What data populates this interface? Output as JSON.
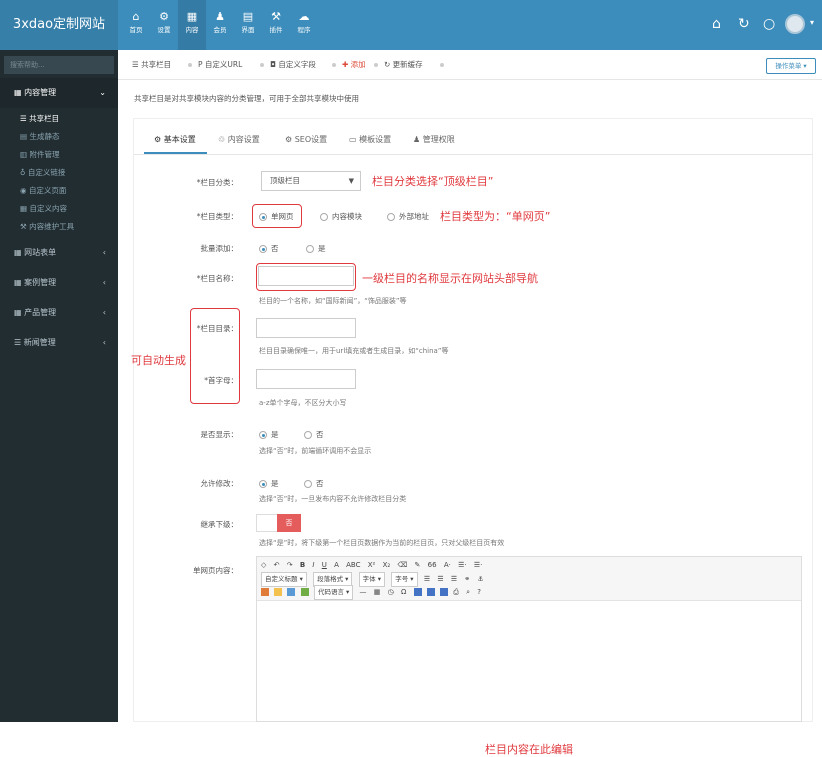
{
  "app": {
    "logo": "3xdao定制网站"
  },
  "topnav": [
    {
      "icon": "home-icon",
      "glyph": "⌂",
      "label": "首页"
    },
    {
      "icon": "gear-icon",
      "glyph": "⚙",
      "label": "设置"
    },
    {
      "icon": "grid-icon",
      "glyph": "▦",
      "label": "内容"
    },
    {
      "icon": "user-icon",
      "glyph": "♟",
      "label": "会员"
    },
    {
      "icon": "layout-icon",
      "glyph": "▤",
      "label": "界面"
    },
    {
      "icon": "plugin-icon",
      "glyph": "⚒",
      "label": "插件"
    },
    {
      "icon": "cloud-icon",
      "glyph": "☁",
      "label": "程序"
    }
  ],
  "topright": {
    "home": "⌂",
    "refresh": "↻",
    "power": "○"
  },
  "sidebar": {
    "search_placeholder": "搜索帮助...",
    "group_content": "内容管理",
    "items": [
      "共享栏目",
      "生成静态",
      "附件管理",
      "自定义链接",
      "自定义页面",
      "自定义内容",
      "内容维护工具"
    ],
    "groups": [
      "网站表单",
      "案例管理",
      "产品管理",
      "新闻管理"
    ]
  },
  "crumbs": [
    "共享栏目",
    "自定义URL",
    "自定义字段",
    "添加",
    "更新缓存"
  ],
  "ops_button": "操作菜单",
  "description": "共享栏目是对共享模块内容的分类管理，可用于全部共享模块中使用",
  "tabs": [
    "基本设置",
    "内容设置",
    "SEO设置",
    "模板设置",
    "管理权限"
  ],
  "form": {
    "category_label": "*栏目分类：",
    "category_value": "顶级栏目",
    "type_label": "*栏目类型：",
    "type_options": [
      "单网页",
      "内容模块",
      "外部地址"
    ],
    "batch_label": "批量添加：",
    "no": "否",
    "yes": "是",
    "name_label": "*栏目名称：",
    "name_hint": "栏目的一个名称，如“国际新闻”，“饰品服装”等",
    "dir_label": "*栏目目录：",
    "dir_hint": "栏目目录确保唯一，用于url填充或者生成目录，如“china”等",
    "initial_label": "*首字母：",
    "initial_hint": "a-z单个字母，不区分大小写",
    "show_label": "是否显示：",
    "show_hint": "选择“否”时，前端循环调用不会显示",
    "edit_label": "允许修改：",
    "edit_hint": "选择“否”时，一旦发布内容不允许修改栏目分类",
    "inherit_label": "继承下级：",
    "inherit_value": "否",
    "inherit_hint": "选择“是”时，将下级第一个栏目页数据作为当前的栏目页，只对父级栏目页有效",
    "page_content_label": "单网页内容："
  },
  "editor": {
    "row1": [
      "B",
      "I",
      "U",
      "A",
      "ABC",
      "X²",
      "X₂",
      "66",
      "A·",
      "☰·",
      "☰·"
    ],
    "row2_combos": [
      "自定义标题",
      "段落格式",
      "字体",
      "字号"
    ],
    "code_lang": "代码语言",
    "content_note": "栏目内容在此编辑"
  },
  "annotations": {
    "category": "栏目分类选择“顶级栏目”",
    "type": "栏目类型为：“单网页”",
    "name": "一级栏目的名称显示在网站头部导航",
    "auto": "可自动生成"
  },
  "colors": {
    "primary": "#3c8dbc",
    "sidebar": "#222d32",
    "annotation": "#e0393e"
  }
}
